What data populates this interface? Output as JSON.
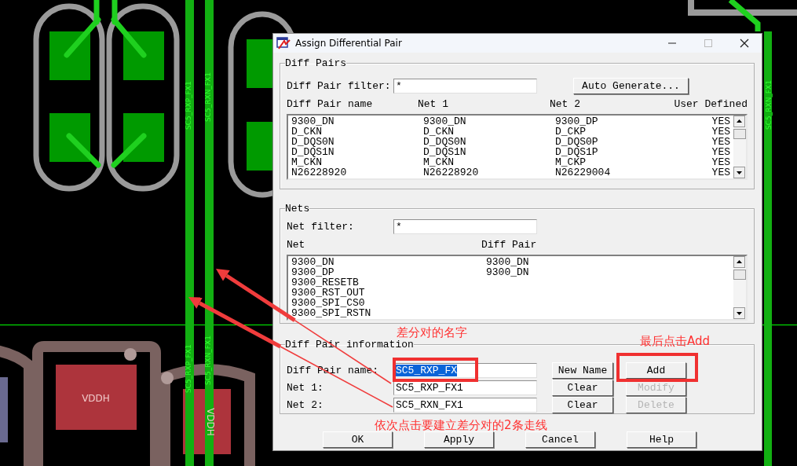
{
  "pcb": {
    "trace_labels": [
      "SC5_RXP_FX1",
      "SC5_RXN_FX1",
      "SC5_RXP_FX1",
      "SC5_RXN_FX1",
      "SC5_RXN_FX1"
    ],
    "pad_labels": [
      "VDDH",
      "VDDH"
    ]
  },
  "dialog": {
    "title": "Assign Differential Pair",
    "diff_pairs": {
      "legend": "Diff Pairs",
      "filter_label": "Diff Pair filter:",
      "filter_value": "*",
      "button": "Auto Generate...",
      "columns": [
        "Diff Pair name",
        "Net 1",
        "Net 2",
        "User Defined"
      ],
      "rows": [
        [
          "9300_DN",
          "9300_DN",
          "9300_DP",
          "YES"
        ],
        [
          "D_CKN",
          "D_CKN",
          "D_CKP",
          "YES"
        ],
        [
          "D_DQS0N",
          "D_DQS0N",
          "D_DQS0P",
          "YES"
        ],
        [
          "D_DQS1N",
          "D_DQS1N",
          "D_DQS1P",
          "YES"
        ],
        [
          "M_CKN",
          "M_CKN",
          "M_CKP",
          "YES"
        ],
        [
          "N26228920",
          "N26228920",
          "N26229004",
          "YES"
        ]
      ]
    },
    "nets": {
      "legend": "Nets",
      "filter_label": "Net filter:",
      "filter_value": "*",
      "columns": [
        "Net",
        "Diff Pair"
      ],
      "rows": [
        [
          "9300_DN",
          "9300_DN"
        ],
        [
          "9300_DP",
          "9300_DN"
        ],
        [
          "9300_RESETB",
          ""
        ],
        [
          "9300_RST_OUT",
          ""
        ],
        [
          "9300_SPI_CS0",
          ""
        ],
        [
          "9300_SPI_RSTN",
          ""
        ]
      ]
    },
    "info": {
      "legend": "Diff Pair information",
      "rows": [
        {
          "label": "Diff Pair name:",
          "value": "SC5_RXP_FX",
          "highlighted": true,
          "buttons": [
            {
              "label": "New Name",
              "disabled": false
            },
            {
              "label": "Add",
              "disabled": false
            }
          ]
        },
        {
          "label": "Net 1:",
          "value": "SC5_RXP_FX1",
          "highlighted": false,
          "buttons": [
            {
              "label": "Clear",
              "disabled": false
            },
            {
              "label": "Modify",
              "disabled": true
            }
          ]
        },
        {
          "label": "Net 2:",
          "value": "SC5_RXN_FX1",
          "highlighted": false,
          "buttons": [
            {
              "label": "Clear",
              "disabled": false
            },
            {
              "label": "Delete",
              "disabled": true
            }
          ]
        }
      ]
    },
    "buttons": [
      "OK",
      "Apply",
      "Cancel",
      "Help"
    ]
  },
  "annotations": [
    {
      "text": "差分对的名字"
    },
    {
      "text": "最后点击Add"
    },
    {
      "text": "依次点击要建立差分对的2条走线"
    }
  ]
}
